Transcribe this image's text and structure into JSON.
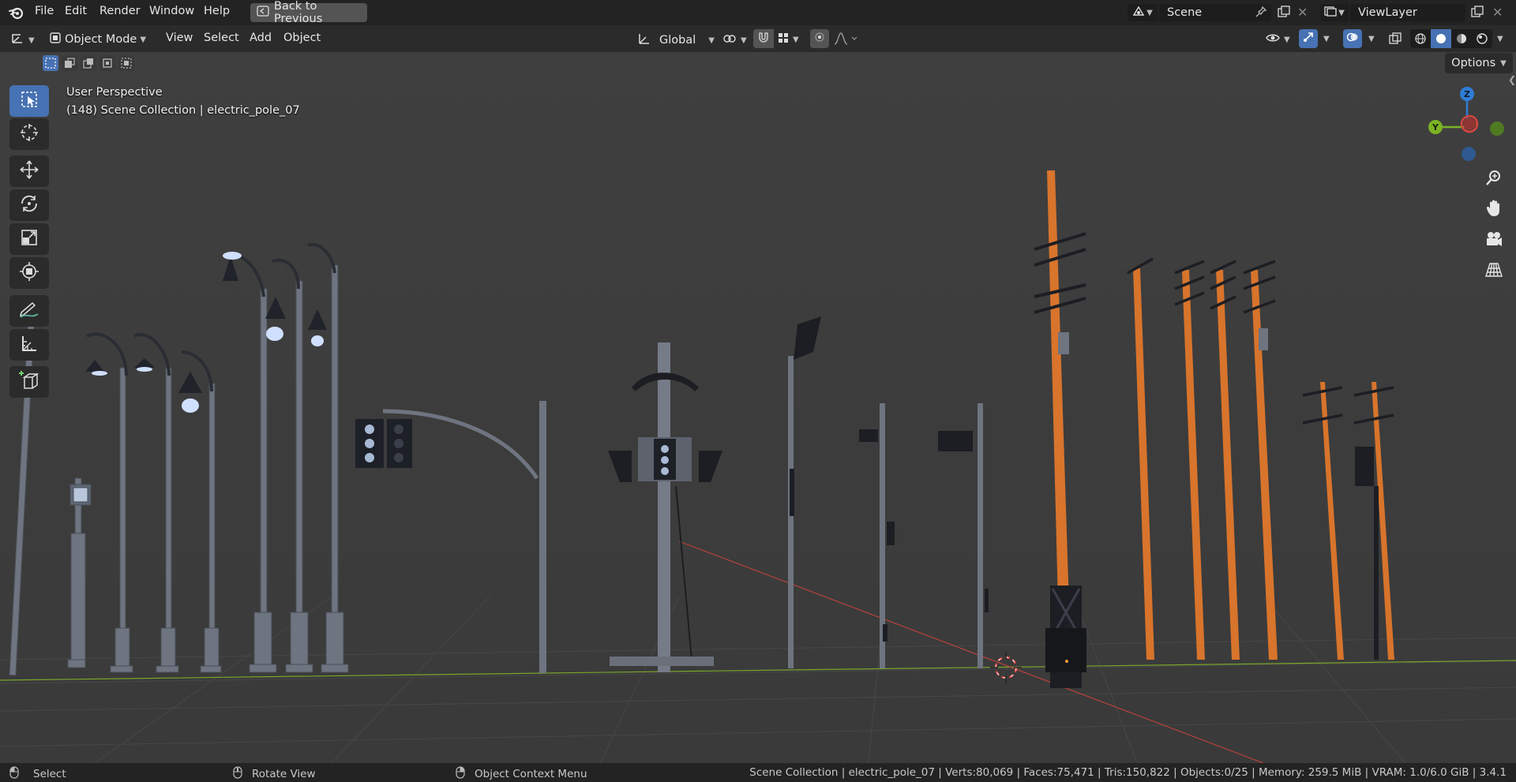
{
  "topbar": {
    "menus": [
      "File",
      "Edit",
      "Render",
      "Window",
      "Help"
    ],
    "back_button": "Back to Previous",
    "scene_label": "Scene",
    "view_layer_label": "ViewLayer"
  },
  "header": {
    "mode": "Object Mode",
    "menus": [
      "View",
      "Select",
      "Add",
      "Object"
    ],
    "transform_orientation": "Global",
    "options_label": "Options"
  },
  "viewport": {
    "perspective": "User Perspective",
    "collection_info": "(148) Scene Collection | electric_pole_07",
    "axes": {
      "z": "Z",
      "y": "Y"
    }
  },
  "statusbar": {
    "select": "Select",
    "rotate": "Rotate View",
    "context": "Object Context Menu",
    "stats": "Scene Collection | electric_pole_07 | Verts:80,069 | Faces:75,471 | Tris:150,822 | Objects:0/25 | Memory: 259.5 MiB | VRAM: 1.0/6.0 GiB | 3.4.1"
  },
  "colors": {
    "accent": "#4772b3",
    "axis_x": "#d4453f",
    "axis_y": "#7bb324",
    "axis_z": "#2f7dd6",
    "pole_orange": "#d8742c"
  }
}
